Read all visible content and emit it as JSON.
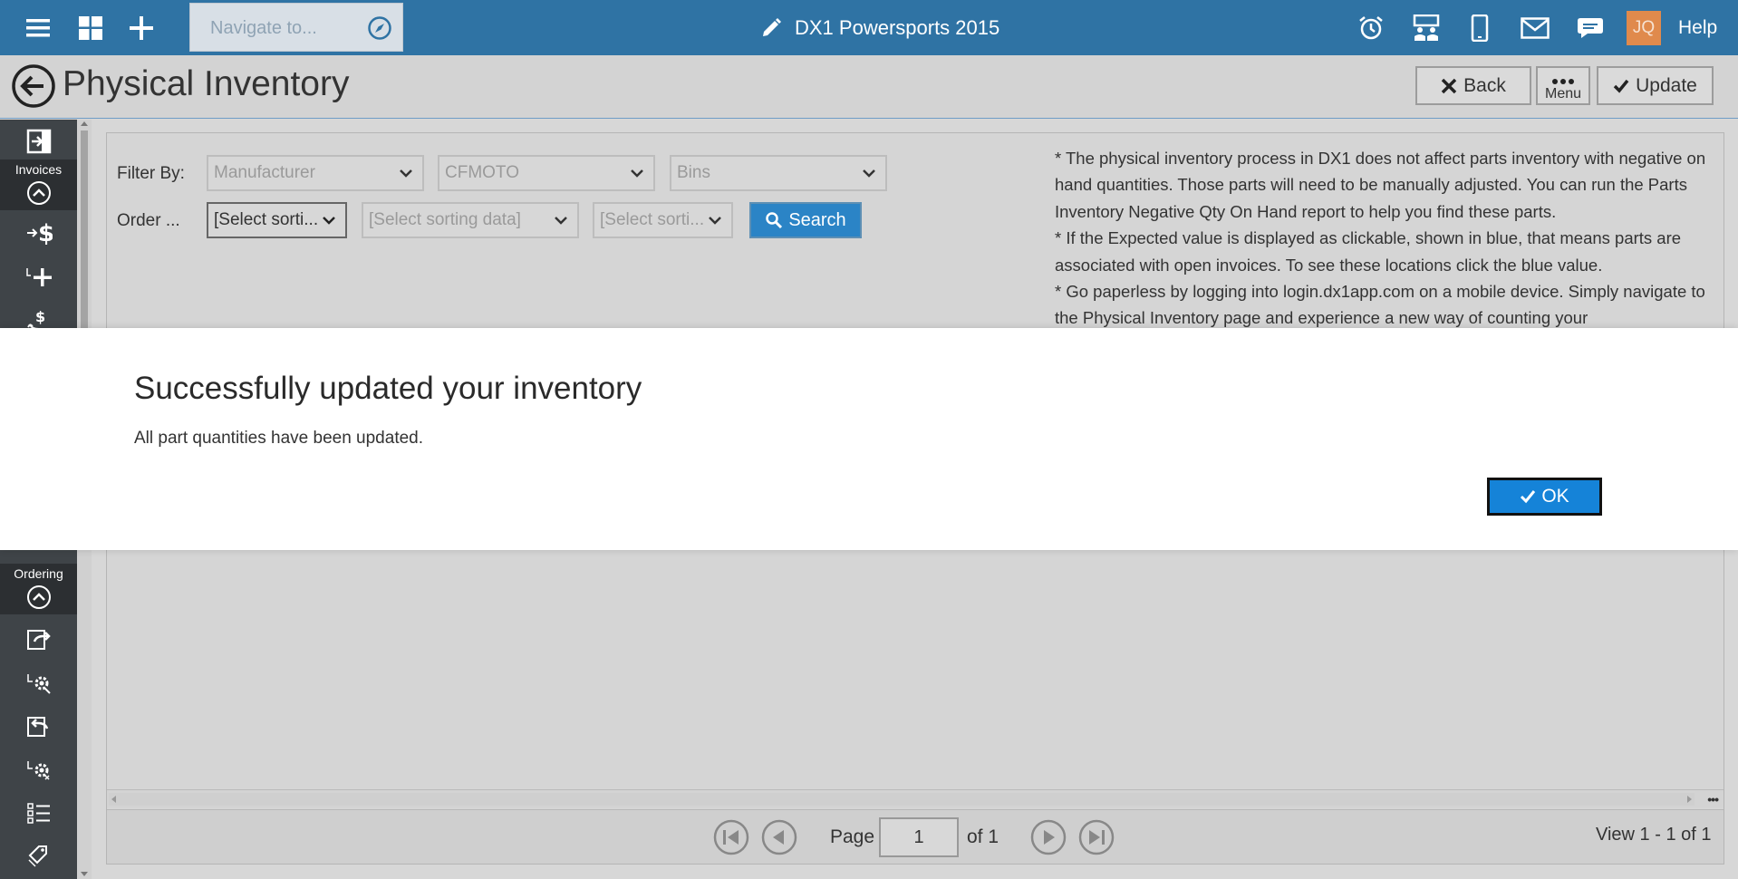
{
  "topbar": {
    "navigate_placeholder": "Navigate to...",
    "app_title": "DX1 Powersports 2015",
    "avatar_initials": "JQ",
    "help_label": "Help",
    "icons": [
      "hamburger-menu-icon",
      "dashboard-grid-icon",
      "plus-icon",
      "compass-icon",
      "pencil-icon",
      "alarm-clock-icon",
      "presentation-icon",
      "mobile-phone-icon",
      "mail-icon",
      "chat-icon"
    ]
  },
  "header": {
    "title": "Physical Inventory",
    "back_label": "Back",
    "menu_label": "Menu",
    "update_label": "Update"
  },
  "sidebar": {
    "sections": [
      {
        "label": "Invoices"
      },
      {
        "label": "Ordering"
      }
    ]
  },
  "filters": {
    "filter_by_label": "Filter By:",
    "order_label": "Order ...",
    "filter1": "Manufacturer",
    "filter2": "CFMOTO",
    "filter3": "Bins",
    "sort1": "[Select sorti...",
    "sort2": "[Select sorting data]",
    "sort3": "[Select sorti...",
    "search_label": "Search"
  },
  "notes": {
    "text": "* The physical inventory process in DX1 does not affect parts inventory with negative on hand quantities. Those parts will need to be manually adjusted. You can run the Parts Inventory Negative Qty On Hand report to help you find these parts.\n* If the Expected value is displayed as clickable, shown in blue, that means parts are associated with open invoices. To see these locations click the blue value.\n* Go paperless by logging into login.dx1app.com on a mobile device. Simply navigate to the Physical Inventory page and experience a new way of counting your"
  },
  "pager": {
    "page_label": "Page",
    "page_value": "1",
    "of_label": "of 1",
    "view_label": "View 1 - 1 of 1"
  },
  "modal": {
    "title": "Successfully updated your inventory",
    "message": "All part quantities have been updated.",
    "ok_label": "OK"
  },
  "colors": {
    "topbar": "#2f73a4",
    "sidebar": "#3f4448",
    "accent": "#1583d8",
    "avatar": "#e08a4c"
  }
}
